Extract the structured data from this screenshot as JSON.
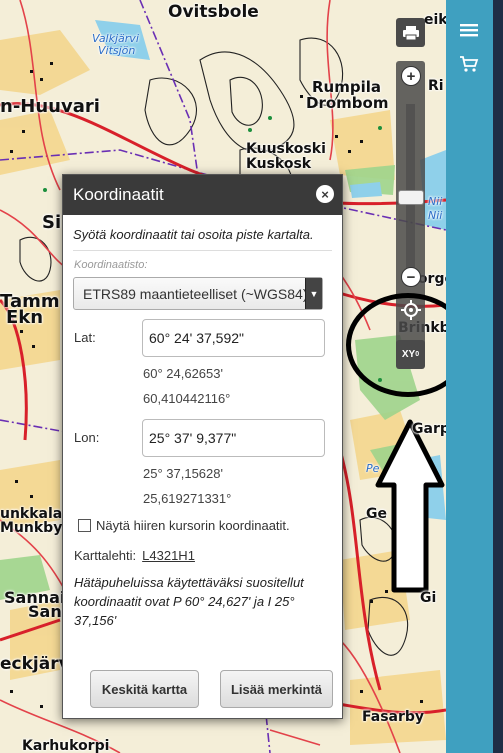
{
  "map": {
    "labels": {
      "ovitsbole": "Ovitsbole",
      "valkjarvi": "Valkjärvi",
      "vitsjon": "Vitsjön",
      "huuvari": "n-Huuvari",
      "rumpila": "Rumpila",
      "drombom": "Drombom",
      "kuuskoski": "Kuuskoski",
      "kuskosk": "Kuskosk",
      "si": "Si",
      "tamm": "Tamm",
      "ekn": "Ekn",
      "morgo": "Morgo",
      "brinkb": "Brinkb",
      "garp": "Garp",
      "pe": "Pe",
      "kunkkala": "unkkala",
      "munkby": "Munkby",
      "sannai": "Sannai",
      "sanna": "Sanna",
      "eckjarv": "eckjärv",
      "fasarby": "Fasarby",
      "karhukorpi": "Karhukorpi",
      "ge": "Ge",
      "gi": "Gi",
      "nii": "Nii",
      "nii2": "Nii",
      "ri": "Ri",
      "eik": "eik"
    }
  },
  "sidebar": {
    "menu_icon": "hamburger-menu-icon",
    "cart_icon": "shopping-cart-icon"
  },
  "zoom_toolbar": {
    "print_icon": "printer-icon",
    "zoom_in_label": "+",
    "zoom_out_label": "−",
    "locate_icon": "crosshair-locate-icon",
    "xy_label": "XY",
    "xy_sup": "0"
  },
  "dialog": {
    "title": "Koordinaatit",
    "close_label": "×",
    "intro": "Syötä koordinaatit tai osoita piste kartalta.",
    "crs_label": "Koordinaatisto:",
    "crs_value": "ETRS89 maantieteelliset (~WGS84)",
    "lat_label": "Lat:",
    "lat_value": "60° 24' 37,592\"",
    "lat_dm": "60° 24,62653'",
    "lat_dd": "60,410442116°",
    "lon_label": "Lon:",
    "lon_value": "25° 37' 9,377\"",
    "lon_dm": "25° 37,15628'",
    "lon_dd": "25,619271331°",
    "cursor_checkbox_label": "Näytä hiiren kursorin koordinaatit.",
    "map_sheet_label": "Karttalehti:",
    "map_sheet_value": "L4321H1",
    "emergency_text": "Hätäpuheluissa käytettäväksi suositellut koordinaatit ovat P 60° 24,627' ja I 25° 37,156'",
    "center_button": "Keskitä kartta",
    "add_marker_button": "Lisää merkintä"
  },
  "colors": {
    "sidebar": "#3fa0c0",
    "dialog_header": "#3a3a3a",
    "toolbar": "#4a4a4a",
    "road_red": "#d8202a",
    "boundary_purple": "#6a2fb4",
    "water_blue": "#7ec8e3",
    "field_yellow": "#f3d27a",
    "field_green": "#9ed08a"
  }
}
